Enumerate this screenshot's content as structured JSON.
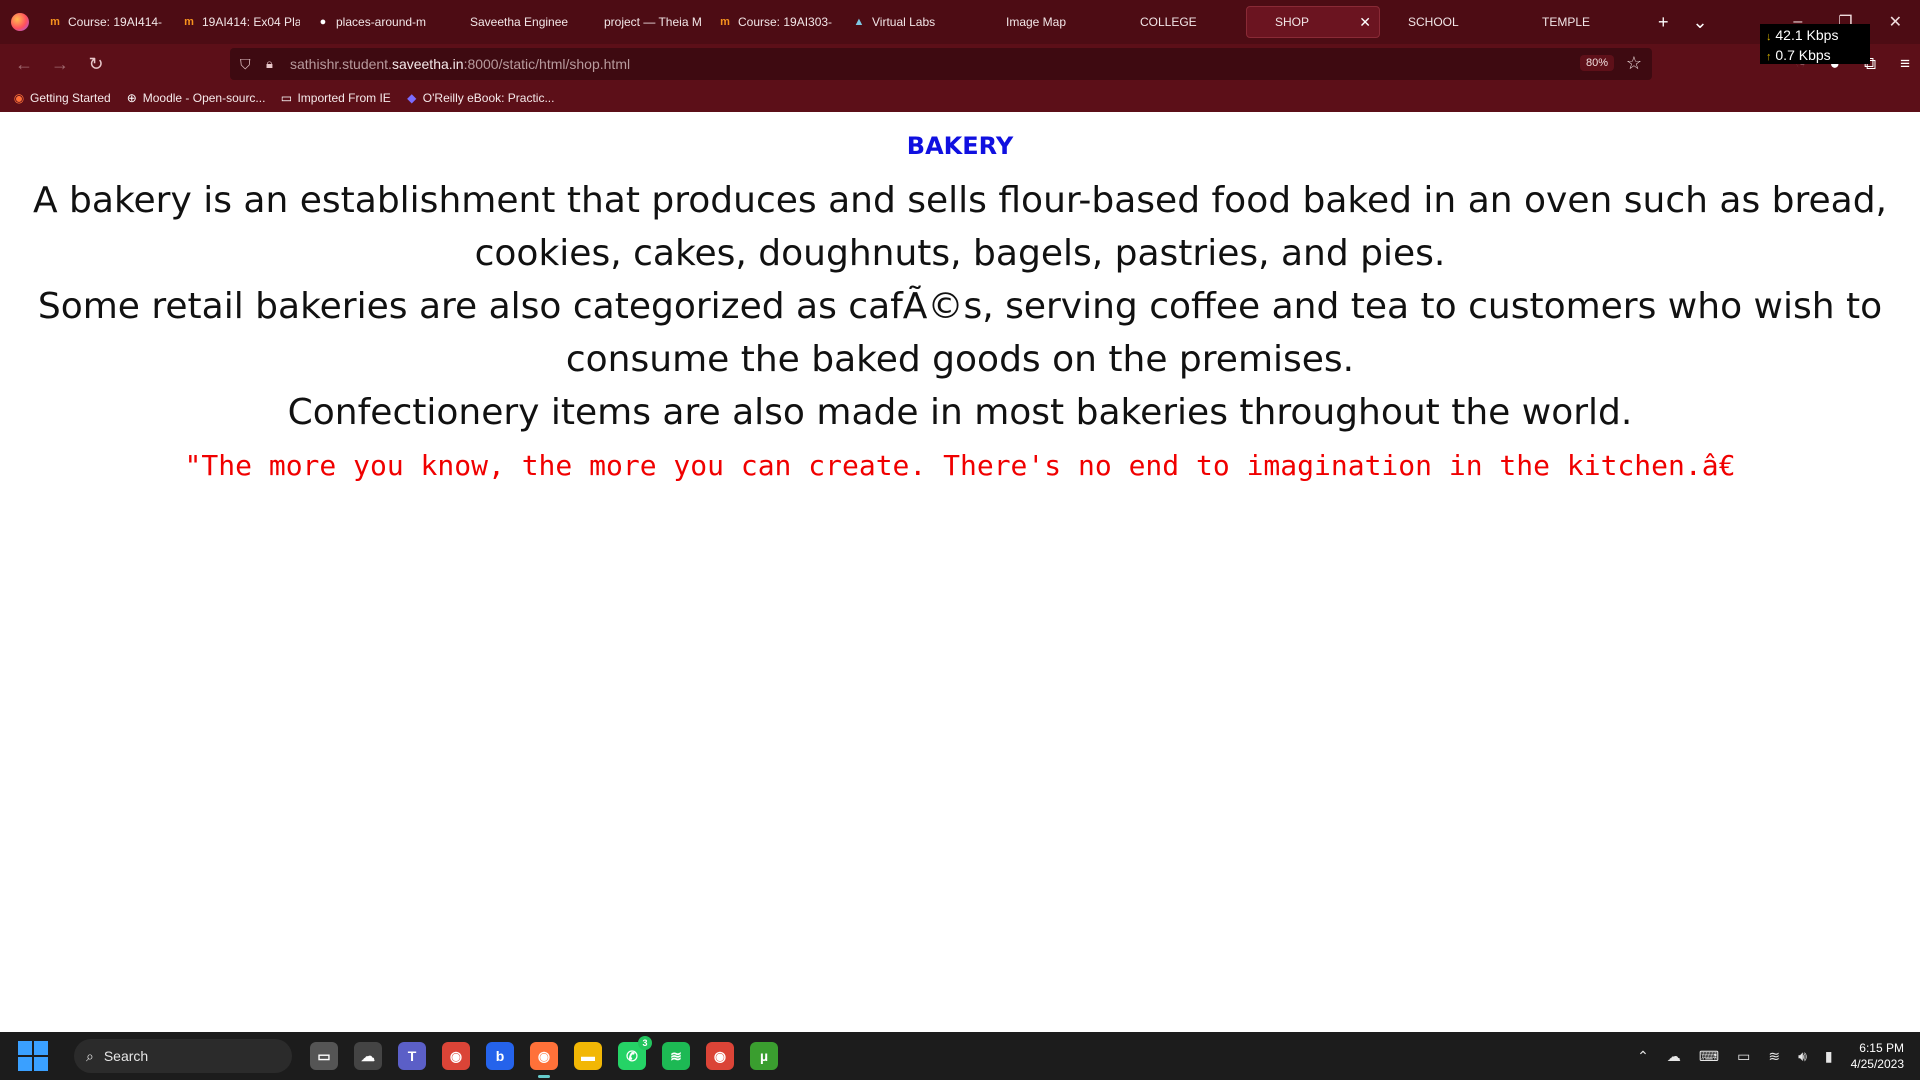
{
  "tabs": [
    {
      "icon": "moodle-icon",
      "glyph": "m",
      "color": "#f7931e",
      "label": "Course: 19AI414-"
    },
    {
      "icon": "moodle-icon",
      "glyph": "m",
      "color": "#f7931e",
      "label": "19AI414: Ex04 Pla"
    },
    {
      "icon": "github-icon",
      "glyph": "●",
      "color": "#ffffff",
      "label": "places-around-m"
    },
    {
      "icon": "blank-page-icon",
      "glyph": "",
      "color": "#ffffff",
      "label": "Saveetha Engineering"
    },
    {
      "icon": "blank-page-icon",
      "glyph": "",
      "color": "#ffffff",
      "label": "project — Theia Mult"
    },
    {
      "icon": "moodle-icon",
      "glyph": "m",
      "color": "#f7931e",
      "label": "Course: 19AI303-"
    },
    {
      "icon": "virtual-labs-icon",
      "glyph": "▲",
      "color": "#7ec8e3",
      "label": "Virtual Labs"
    },
    {
      "icon": "blank-page-icon",
      "glyph": "",
      "color": "#ffffff",
      "label": "Image Map"
    },
    {
      "icon": "blank-page-icon",
      "glyph": "",
      "color": "#ffffff",
      "label": "COLLEGE"
    },
    {
      "icon": "blank-page-icon",
      "glyph": "",
      "color": "#ffffff",
      "label": "SHOP",
      "active": true
    },
    {
      "icon": "blank-page-icon",
      "glyph": "",
      "color": "#ffffff",
      "label": "SCHOOL"
    },
    {
      "icon": "blank-page-icon",
      "glyph": "",
      "color": "#ffffff",
      "label": "TEMPLE"
    }
  ],
  "network": {
    "down": "42.1 Kbps",
    "up": "0.7 Kbps"
  },
  "urlbar": {
    "prefix": "sathishr.student.",
    "host": "saveetha.in",
    "suffix": ":8000/static/html/shop.html",
    "zoom": "80%"
  },
  "bookmarks": [
    {
      "icon": "firefox-icon",
      "label": "Getting Started"
    },
    {
      "icon": "globe-icon",
      "label": "Moodle - Open-sourc..."
    },
    {
      "icon": "folder-icon",
      "label": "Imported From IE"
    },
    {
      "icon": "oreilly-icon",
      "label": "O'Reilly eBook: Practic..."
    }
  ],
  "page": {
    "heading": "BAKERY",
    "lines": [
      "A bakery is an establishment that produces and sells flour-based food baked in an oven such as bread,",
      "cookies, cakes, doughnuts, bagels, pastries, and pies.",
      "Some retail bakeries are also categorized as cafÃ©s, serving coffee and tea to customers who wish to",
      "consume the baked goods on the premises.",
      "Confectionery items are also made in most bakeries throughout the world."
    ],
    "quote": "\"The more you know, the more you can create. There's no end to imagination in the kitchen.â€"
  },
  "taskbar": {
    "search_label": "Search",
    "apps": [
      {
        "name": "task-view-icon",
        "color": "#555555",
        "glyph": "▭"
      },
      {
        "name": "weather-icon",
        "color": "#444444",
        "glyph": "☁"
      },
      {
        "name": "teams-icon",
        "color": "#5b5fc7",
        "glyph": "T"
      },
      {
        "name": "chrome-icon",
        "color": "#db4437",
        "glyph": "◉"
      },
      {
        "name": "bing-icon",
        "color": "#2563eb",
        "glyph": "b"
      },
      {
        "name": "firefox-icon",
        "color": "#ff7139",
        "glyph": "◉",
        "active": true
      },
      {
        "name": "file-explorer-icon",
        "color": "#f2b705",
        "glyph": "▬"
      },
      {
        "name": "whatsapp-icon",
        "color": "#25d366",
        "glyph": "✆",
        "badge": "3"
      },
      {
        "name": "spotify-icon",
        "color": "#1db954",
        "glyph": "≋"
      },
      {
        "name": "chrome-icon",
        "color": "#db4437",
        "glyph": "◉"
      },
      {
        "name": "utorrent-icon",
        "color": "#3a9e2f",
        "glyph": "µ"
      }
    ],
    "time": "6:15 PM",
    "date": "4/25/2023"
  }
}
